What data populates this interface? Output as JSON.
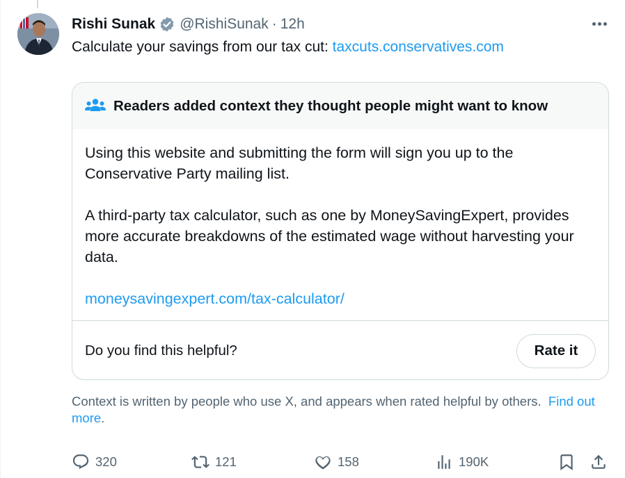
{
  "tweet": {
    "author_name": "Rishi Sunak",
    "handle": "@RishiSunak",
    "separator": "·",
    "time": "12h",
    "text": "Calculate your savings from our tax cut: ",
    "link": "taxcuts.conservatives.com"
  },
  "community_note": {
    "title": "Readers added context they thought people might want to know",
    "paragraph_1": "Using this website and submitting the form will sign you up to the Conservative Party mailing list.",
    "paragraph_2": "A third-party tax calculator, such as one by MoneySavingExpert, provides more accurate breakdowns of the estimated wage without harvesting your data.",
    "link": "moneysavingexpert.com/tax-calculator/",
    "helpful_question": "Do you find this helpful?",
    "rate_button": "Rate it"
  },
  "context_footer": {
    "text": "Context is written by people who use X, and appears when rated helpful by others.",
    "link": "Find out more",
    "period": "."
  },
  "actions": {
    "replies": "320",
    "retweets": "121",
    "likes": "158",
    "views": "190K"
  },
  "colors": {
    "accent": "#1d9bf0",
    "secondary_text": "#536471",
    "border": "#cfd9de",
    "note_header_bg": "#f7f9f9",
    "verified_badge": "#829aab"
  },
  "icons": [
    "avatar",
    "verified-badge-icon",
    "more-icon",
    "readers-icon",
    "reply-icon",
    "retweet-icon",
    "like-icon",
    "views-icon",
    "bookmark-icon",
    "share-icon"
  ]
}
